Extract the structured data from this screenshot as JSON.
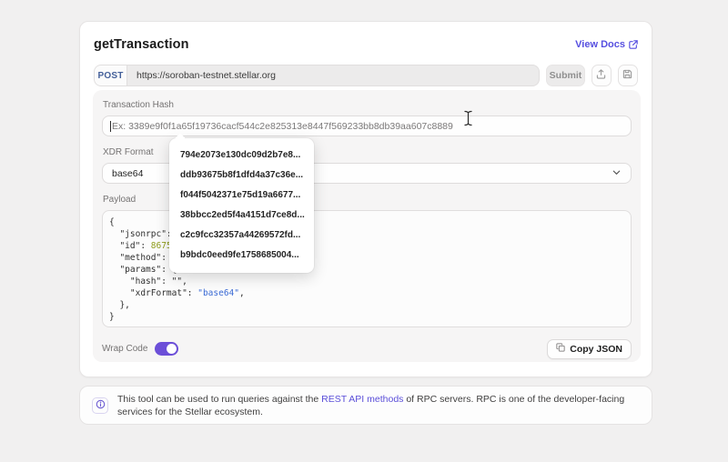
{
  "header": {
    "title": "getTransaction",
    "view_docs_label": "View Docs"
  },
  "request_bar": {
    "method": "POST",
    "url": "https://soroban-testnet.stellar.org",
    "submit_label": "Submit"
  },
  "form": {
    "transaction_hash": {
      "label": "Transaction Hash",
      "value": "",
      "placeholder": "Ex: 3389e9f0f1a65f19736cacf544c2e825313e8447f569233bb8db39aa607c8889"
    },
    "xdr_format": {
      "label": "XDR Format",
      "value": "base64"
    },
    "payload": {
      "label": "Payload",
      "lines": [
        {
          "seg0": "{"
        },
        {
          "seg0": "  \"jsonrpc\": "
        },
        {
          "seg0": "  \"id\": ",
          "number": "86753"
        },
        {
          "seg0": "  \"method\": \""
        },
        {
          "seg0": "  \"params\": {"
        },
        {
          "seg0": "    \"hash\": \"\","
        },
        {
          "seg0": "    \"xdrFormat\": ",
          "string": "\"base64\"",
          "seg1": ","
        },
        {
          "seg0": "  },"
        },
        {
          "seg0": "}"
        }
      ]
    },
    "wrap_code": {
      "label": "Wrap Code",
      "state": "on"
    },
    "copy_json_label": "Copy JSON"
  },
  "suggestions": {
    "items": [
      {
        "label": "794e2073e130dc09d2b7e8..."
      },
      {
        "label": "ddb93675b8f1dfd4a37c36e..."
      },
      {
        "label": "f044f5042371e75d19a6677..."
      },
      {
        "label": "38bbcc2ed5f4a4151d7ce8d..."
      },
      {
        "label": "c2c9fcc32357a44269572fd..."
      },
      {
        "label": "b9bdc0eed9fe1758685004..."
      }
    ]
  },
  "note": {
    "text_before_link": "This tool can be used to run queries against the ",
    "link_text": "REST API methods",
    "text_after_link": " of RPC servers. RPC is one of the developer-facing services for the Stellar ecosystem."
  },
  "colors": {
    "accent_purple": "#6c4fd8",
    "link_indigo": "#564fe0",
    "method_blue": "#44609a",
    "json_number_green": "#8f9d1c",
    "json_string_blue": "#3a6ad4",
    "panel_gray": "#f6f5f5",
    "page_background": "#f1f0f0"
  }
}
